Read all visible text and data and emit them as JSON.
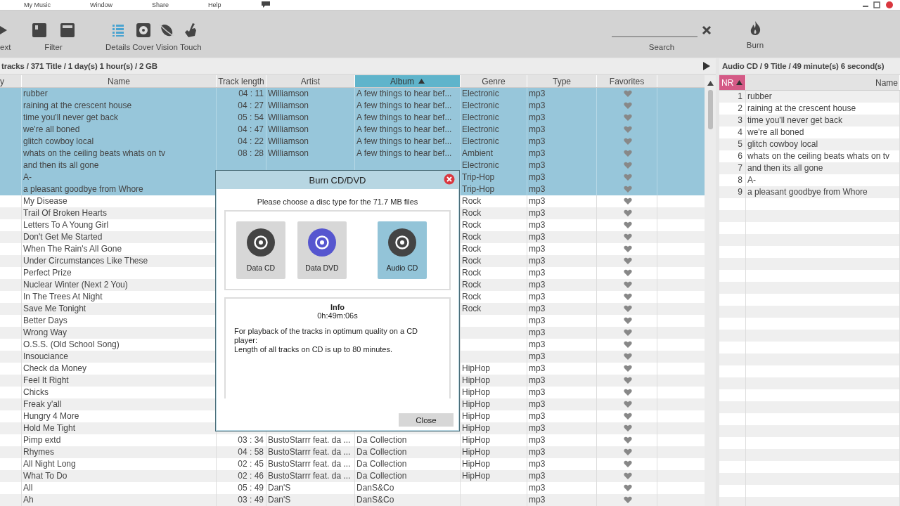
{
  "menu": [
    "My Music",
    "Window",
    "Share",
    "Help"
  ],
  "toolbar": {
    "items": [
      {
        "label": "ext",
        "kind": "next"
      },
      {
        "label": "Filter",
        "kind": "filter"
      },
      {
        "label": "Details",
        "kind": "details",
        "selected": true
      },
      {
        "label": "Cover",
        "kind": "cover",
        "selected": false
      },
      {
        "label": "Vision",
        "kind": "vision",
        "selected": false
      },
      {
        "label": "Touch",
        "kind": "touch",
        "selected": false
      }
    ],
    "search": {
      "label": "Search"
    },
    "burn": {
      "label": "Burn"
    }
  },
  "library": {
    "status": "tracks / 371 Title / 1 day(s) 1 hour(s) / 2 GB",
    "columns": [
      {
        "label": "y",
        "sorted": false
      },
      {
        "label": "Name",
        "sorted": false
      },
      {
        "label": "Track length",
        "sorted": false
      },
      {
        "label": "Artist",
        "sorted": false
      },
      {
        "label": "Album",
        "sorted": true
      },
      {
        "label": "Genre",
        "sorted": false
      },
      {
        "label": "Type",
        "sorted": false
      },
      {
        "label": "Favorites",
        "sorted": false
      }
    ],
    "rows": [
      {
        "name": "rubber",
        "length": "04 : 11",
        "artist": "Williamson",
        "album": "A few things to hear bef...",
        "genre": "Electronic",
        "type": "mp3",
        "selected": true
      },
      {
        "name": "raining at the crescent house",
        "length": "04 : 27",
        "artist": "Williamson",
        "album": "A few things to hear bef...",
        "genre": "Electronic",
        "type": "mp3",
        "selected": true
      },
      {
        "name": "time you'll never get back",
        "length": "05 : 54",
        "artist": "Williamson",
        "album": "A few things to hear bef...",
        "genre": "Electronic",
        "type": "mp3",
        "selected": true
      },
      {
        "name": "we're all boned",
        "length": "04 : 47",
        "artist": "Williamson",
        "album": "A few things to hear bef...",
        "genre": "Electronic",
        "type": "mp3",
        "selected": true
      },
      {
        "name": "glitch cowboy local",
        "length": "04 : 22",
        "artist": "Williamson",
        "album": "A few things to hear bef...",
        "genre": "Electronic",
        "type": "mp3",
        "selected": true
      },
      {
        "name": "whats on the ceiling beats whats on tv",
        "length": "08 : 28",
        "artist": "Williamson",
        "album": "A few things to hear bef...",
        "genre": "Ambient",
        "type": "mp3",
        "selected": true
      },
      {
        "name": "and then its all gone",
        "genre": "Electronic",
        "type": "mp3",
        "selected": true
      },
      {
        "name": "A-",
        "genre": "Trip-Hop",
        "type": "mp3",
        "selected": true
      },
      {
        "name": "a pleasant goodbye from Whore",
        "genre": "Trip-Hop",
        "type": "mp3",
        "selected": true
      },
      {
        "name": "My Disease",
        "genre": "Rock",
        "type": "mp3",
        "selected": false
      },
      {
        "name": "Trail Of Broken Hearts",
        "genre": "Rock",
        "type": "mp3",
        "selected": false
      },
      {
        "name": "Letters To A Young Girl",
        "genre": "Rock",
        "type": "mp3",
        "selected": false
      },
      {
        "name": "Don't Get Me Started",
        "genre": "Rock",
        "type": "mp3",
        "selected": false
      },
      {
        "name": "When The Rain's All Gone",
        "genre": "Rock",
        "type": "mp3",
        "selected": false
      },
      {
        "name": "Under Circumstances Like These",
        "genre": "Rock",
        "type": "mp3",
        "selected": false
      },
      {
        "name": "Perfect Prize",
        "genre": "Rock",
        "type": "mp3",
        "selected": false
      },
      {
        "name": "Nuclear Winter (Next 2 You)",
        "genre": "Rock",
        "type": "mp3",
        "selected": false
      },
      {
        "name": "In The Trees At Night",
        "genre": "Rock",
        "type": "mp3",
        "selected": false
      },
      {
        "name": "Save Me Tonight",
        "genre": "Rock",
        "type": "mp3",
        "selected": false
      },
      {
        "name": "Better Days",
        "type": "mp3",
        "selected": false
      },
      {
        "name": "Wrong Way",
        "type": "mp3",
        "selected": false
      },
      {
        "name": "O.S.S. (Old School Song)",
        "type": "mp3",
        "selected": false
      },
      {
        "name": "Insouciance",
        "type": "mp3",
        "selected": false
      },
      {
        "name": "Check da Money",
        "genre": "HipHop",
        "type": "mp3",
        "selected": false
      },
      {
        "name": "Feel It Right",
        "genre": "HipHop",
        "type": "mp3",
        "selected": false
      },
      {
        "name": "Chicks",
        "genre": "HipHop",
        "type": "mp3",
        "selected": false
      },
      {
        "name": "Freak y'all",
        "genre": "HipHop",
        "type": "mp3",
        "selected": false
      },
      {
        "name": "Hungry 4 More",
        "genre": "HipHop",
        "type": "mp3",
        "selected": false
      },
      {
        "name": "Hold Me Tight",
        "genre": "HipHop",
        "type": "mp3",
        "selected": false
      },
      {
        "name": "Pimp extd",
        "length": "03 : 34",
        "artist": "BustoStarrr feat. da ...",
        "album": "Da Collection",
        "genre": "HipHop",
        "type": "mp3",
        "selected": false
      },
      {
        "name": "Rhymes",
        "length": "04 : 58",
        "artist": "BustoStarrr feat. da ...",
        "album": "Da Collection",
        "genre": "HipHop",
        "type": "mp3",
        "selected": false
      },
      {
        "name": "All Night Long",
        "length": "02 : 45",
        "artist": "BustoStarrr feat. da ...",
        "album": "Da Collection",
        "genre": "HipHop",
        "type": "mp3",
        "selected": false
      },
      {
        "name": "What To Do",
        "length": "02 : 46",
        "artist": "BustoStarrr feat. da ...",
        "album": "Da Collection",
        "genre": "HipHop",
        "type": "mp3",
        "selected": false
      },
      {
        "name": "All",
        "length": "05 : 49",
        "artist": "Dan'S",
        "album": "DanS&Co",
        "type": "mp3",
        "selected": false
      },
      {
        "name": "Ah",
        "length": "03 : 49",
        "artist": "Dan'S",
        "album": "DanS&Co",
        "type": "mp3",
        "selected": false
      }
    ]
  },
  "burn_list": {
    "status": "Audio CD / 9 Title / 49 minute(s) 6 second(s)",
    "columns": [
      {
        "label": "NR",
        "sorted": true
      },
      {
        "label": "Name",
        "sorted": false
      }
    ],
    "rows": [
      {
        "nr": "1",
        "name": "rubber"
      },
      {
        "nr": "2",
        "name": "raining at the crescent house"
      },
      {
        "nr": "3",
        "name": "time you'll never get back"
      },
      {
        "nr": "4",
        "name": "we're all boned"
      },
      {
        "nr": "5",
        "name": "glitch cowboy local"
      },
      {
        "nr": "6",
        "name": "whats on the ceiling beats whats on tv"
      },
      {
        "nr": "7",
        "name": "and then its all gone"
      },
      {
        "nr": "8",
        "name": "A-"
      },
      {
        "nr": "9",
        "name": "a pleasant goodbye from Whore"
      }
    ]
  },
  "dialog": {
    "title": "Burn CD/DVD",
    "prompt": "Please choose a disc type for the 71.7 MB files",
    "options": [
      {
        "label": "Data CD",
        "kind": "cd",
        "selected": false
      },
      {
        "label": "Data DVD",
        "kind": "dvd",
        "selected": false
      },
      {
        "label": "Audio CD",
        "kind": "cd",
        "selected": true
      }
    ],
    "info": {
      "title": "Info",
      "duration": "0h:49m:06s",
      "lines": [
        "For playback of the tracks in optimum quality on a CD player:",
        "Length of all tracks on CD is up to 80 minutes."
      ]
    },
    "button": "Close"
  }
}
